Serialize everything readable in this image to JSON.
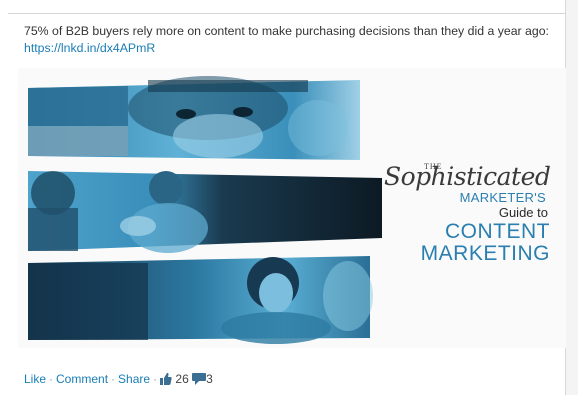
{
  "post": {
    "text": "75% of B2B buyers rely more on content to make purchasing decisions than they did a year ago: ",
    "link": "https://lnkd.in/dx4APmR"
  },
  "image": {
    "title_the": "THE",
    "title_script": "Sophisticated",
    "title_marketers": "MARKETER'S",
    "title_guide": "Guide to",
    "title_content": "CONTENT",
    "title_marketing": "MARKETING"
  },
  "actions": {
    "like_label": "Like",
    "comment_label": "Comment",
    "share_label": "Share",
    "separator": "·",
    "like_count": "26",
    "comment_count": "3",
    "like_icon": "thumbs-up-icon",
    "comment_icon": "speech-bubble-icon"
  },
  "colors": {
    "link": "#1a7db6",
    "photo_tint": "#4ea3cc",
    "photo_shadow": "#0f2f44",
    "title_blue": "#2a7fb0"
  }
}
